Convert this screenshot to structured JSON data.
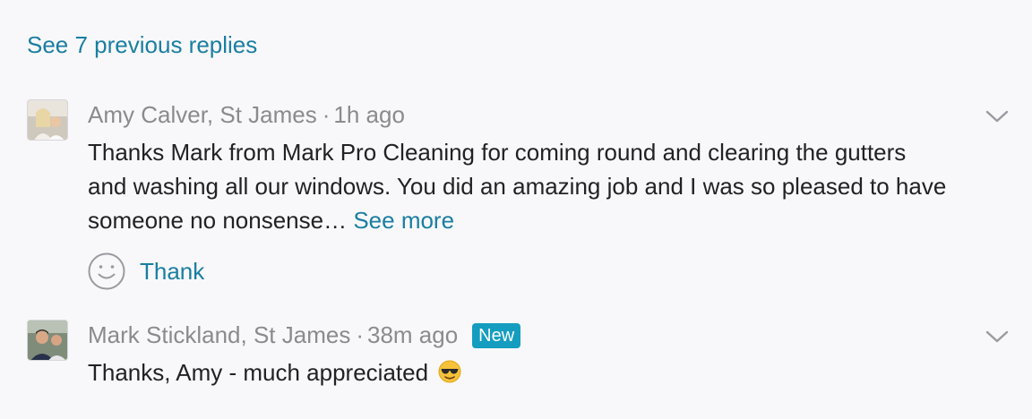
{
  "thread": {
    "see_previous_label": "See 7 previous replies"
  },
  "replies": [
    {
      "author": "Amy Calver, St James",
      "separator": "·",
      "time": "1h ago",
      "body": "Thanks Mark from Mark Pro Cleaning for coming round and clearing the gutters and washing all our windows. You did an amazing job and I was so pleased to have someone no nonsense…",
      "see_more_label": "See more",
      "thank_label": "Thank",
      "avatar_icon": "user-photo-avatar",
      "menu_icon": "chevron-down-icon"
    },
    {
      "author": "Mark Stickland, St James",
      "separator": "·",
      "time": "38m ago",
      "badge": "New",
      "body": "Thanks, Amy - much appreciated",
      "body_emoji": "smiling-face-with-sunglasses",
      "avatar_icon": "user-photo-avatar",
      "menu_icon": "chevron-down-icon"
    }
  ],
  "colors": {
    "background": "#f8f8fa",
    "link": "#1a7ea1",
    "meta": "#8a8a8f",
    "text": "#222226",
    "badge": "#149dbf"
  }
}
